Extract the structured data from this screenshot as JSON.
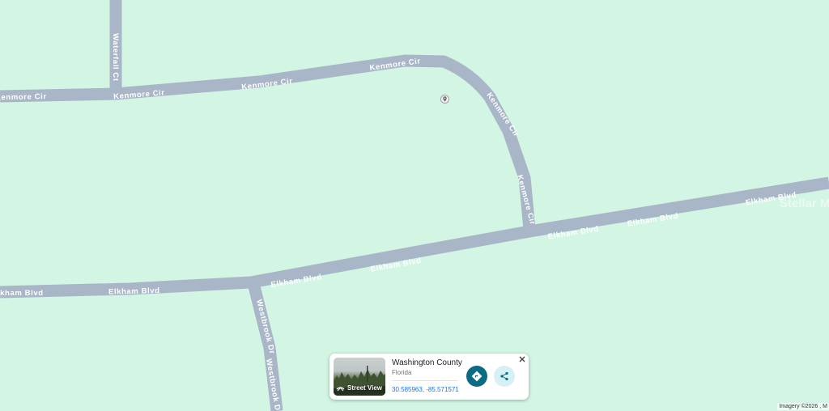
{
  "map": {
    "background_color": "#d3f5e3",
    "road_color": "#a9b6c8",
    "roads": [
      {
        "name": "Kenmore Cir",
        "labels": [
          "Kenmore Cir",
          "Kenmore Cir",
          "Kenmore Cir",
          "Kenmore Cir",
          "Kenmore Cir",
          "Kenmore Cir"
        ]
      },
      {
        "name": "Waterfall Ct",
        "labels": [
          "Waterfall Ct"
        ]
      },
      {
        "name": "Elkham Blvd",
        "labels": [
          "Elkham Blvd",
          "Elkham Blvd",
          "Elkham Blvd",
          "Elkham Blvd",
          "Elkham Blvd",
          "Elkham Blvd",
          "Elkham Blvd"
        ]
      },
      {
        "name": "Westbrook Dr",
        "labels": [
          "Westbrook Dr",
          "Westbrook Dr"
        ]
      }
    ],
    "marker_icon": "location-pin-icon",
    "watermark": "Stellar MLS",
    "attribution": "Imagery ©2026 , M"
  },
  "info_card": {
    "title": "Washington County",
    "subtitle": "Florida",
    "coordinates": "30.585963, -85.571571",
    "street_view_label": "Street View",
    "thumbnail": "street-view-thumbnail",
    "directions_icon": "directions-icon",
    "share_icon": "share-icon",
    "close_icon": "close-icon",
    "accent_color": "#0b6b83"
  }
}
